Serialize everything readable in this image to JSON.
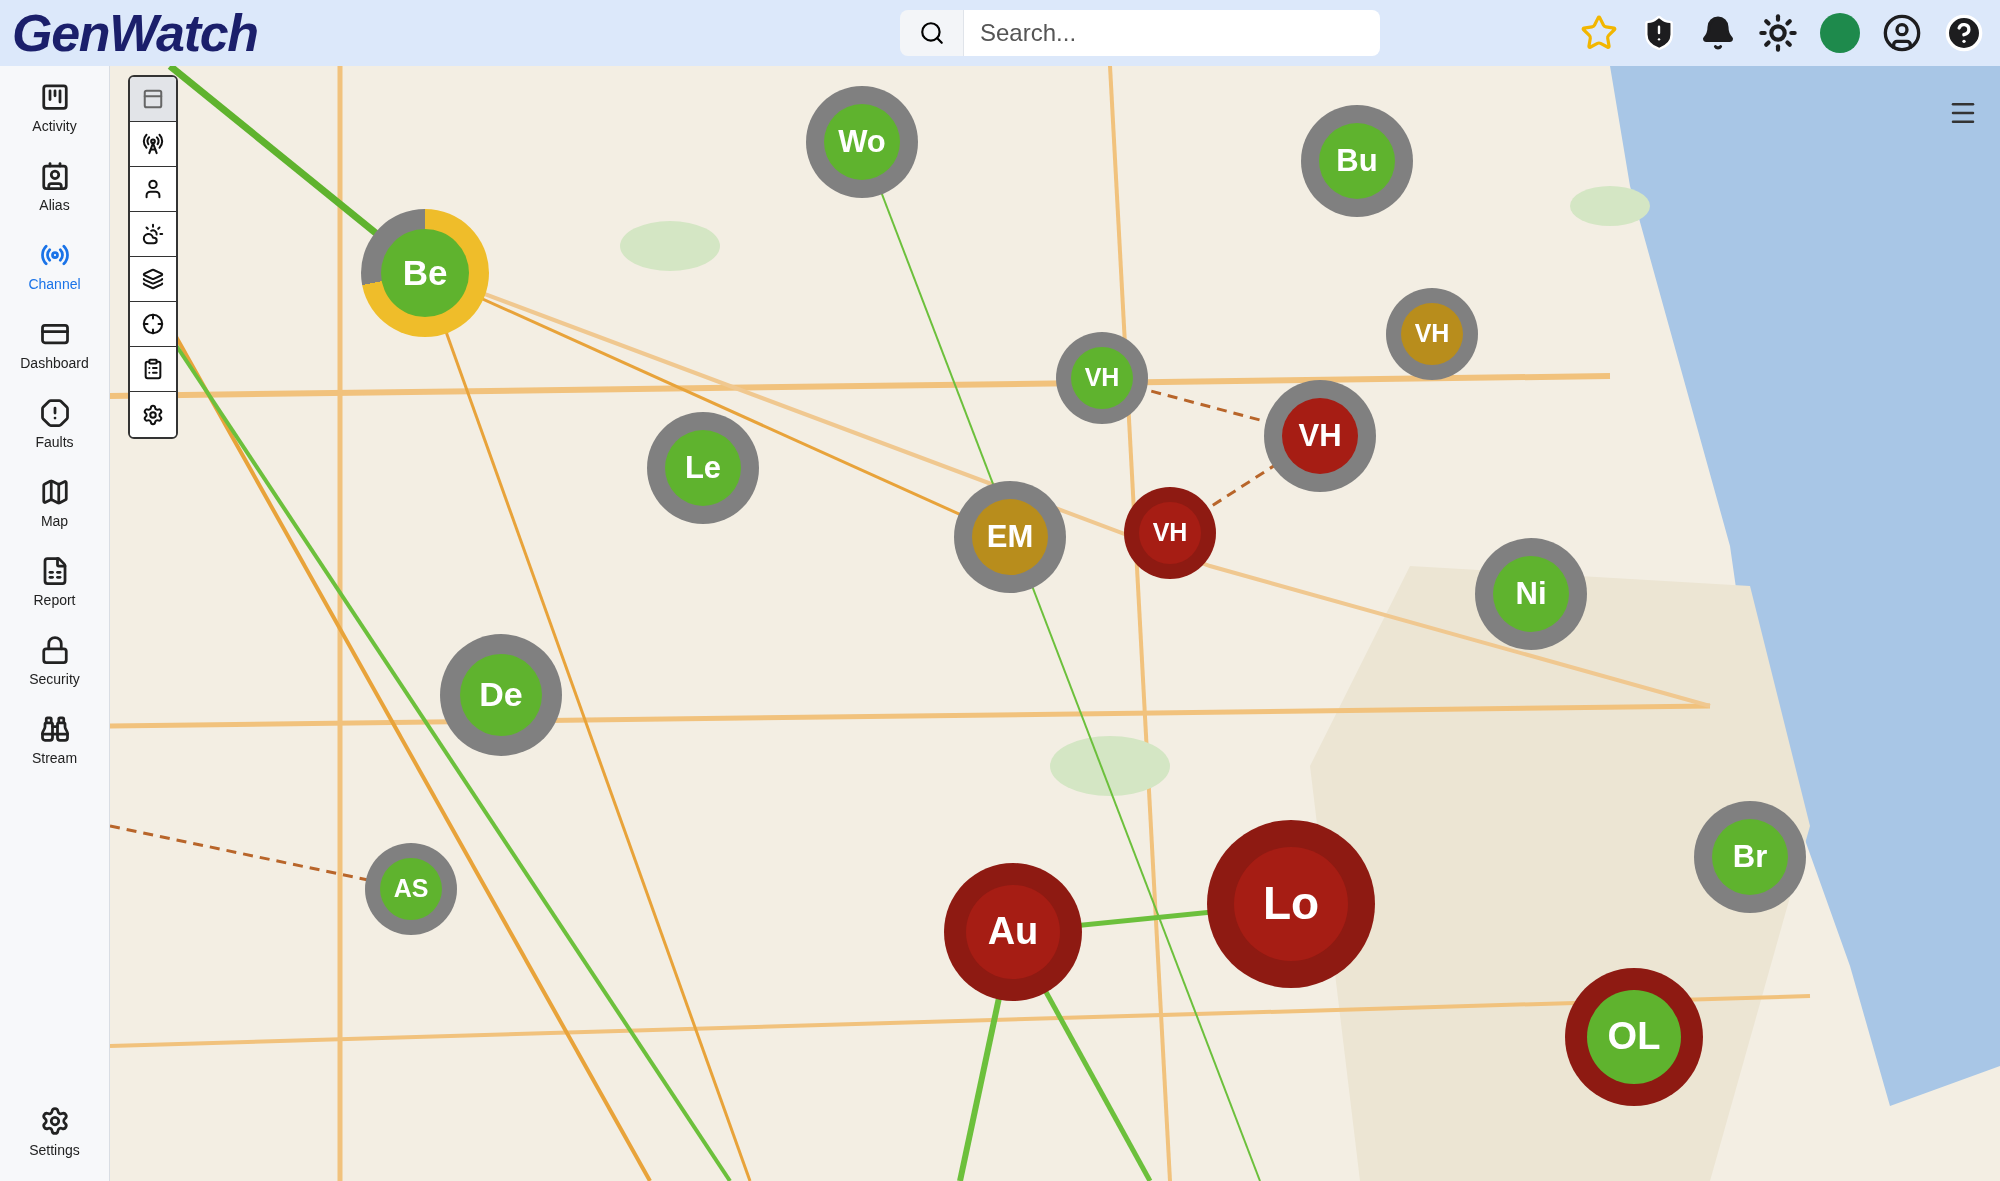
{
  "logo": "GenWatch",
  "search": {
    "placeholder": "Search..."
  },
  "status": {
    "color": "#1e8a4c"
  },
  "sidebar": {
    "items": [
      {
        "label": "Activity",
        "selected": false
      },
      {
        "label": "Alias",
        "selected": false
      },
      {
        "label": "Channel",
        "selected": true
      },
      {
        "label": "Dashboard",
        "selected": false
      },
      {
        "label": "Faults",
        "selected": false
      },
      {
        "label": "Map",
        "selected": false
      },
      {
        "label": "Report",
        "selected": false
      },
      {
        "label": "Security",
        "selected": false
      },
      {
        "label": "Stream",
        "selected": false
      }
    ],
    "footer": {
      "label": "Settings",
      "selected": false
    }
  },
  "map_tools": [
    {
      "selected": true
    },
    {
      "selected": false
    },
    {
      "selected": false
    },
    {
      "selected": false
    },
    {
      "selected": false
    },
    {
      "selected": false
    },
    {
      "selected": false
    },
    {
      "selected": false
    }
  ],
  "markers": [
    {
      "label": "Wo",
      "color": "#5fb32e",
      "warning": false,
      "alarm": false
    },
    {
      "label": "Bu",
      "color": "#5fb32e",
      "warning": false,
      "alarm": false
    },
    {
      "label": "Be",
      "color": "#5fb32e",
      "warning": true,
      "alarm": false
    },
    {
      "label": "VH",
      "color": "#5fb32e",
      "warning": false,
      "alarm": false
    },
    {
      "label": "VH",
      "color": "#b88d1c",
      "warning": false,
      "alarm": false
    },
    {
      "label": "VH",
      "color": "#a61d14",
      "warning": false,
      "alarm": false
    },
    {
      "label": "Le",
      "color": "#5fb32e",
      "warning": false,
      "alarm": false
    },
    {
      "label": "EM",
      "color": "#b88d1c",
      "warning": false,
      "alarm": false
    },
    {
      "label": "VH",
      "color": "#a61d14",
      "warning": false,
      "alarm": true
    },
    {
      "label": "Ni",
      "color": "#5fb32e",
      "warning": false,
      "alarm": false
    },
    {
      "label": "De",
      "color": "#5fb32e",
      "warning": false,
      "alarm": false
    },
    {
      "label": "AS",
      "color": "#5fb32e",
      "warning": false,
      "alarm": false
    },
    {
      "label": "Au",
      "color": "#a61d14",
      "warning": false,
      "alarm": true
    },
    {
      "label": "Lo",
      "color": "#a61d14",
      "warning": false,
      "alarm": true
    },
    {
      "label": "Br",
      "color": "#5fb32e",
      "warning": false,
      "alarm": false
    },
    {
      "label": "OL",
      "color": "#5fb32e",
      "warning": false,
      "alarm": true
    }
  ]
}
